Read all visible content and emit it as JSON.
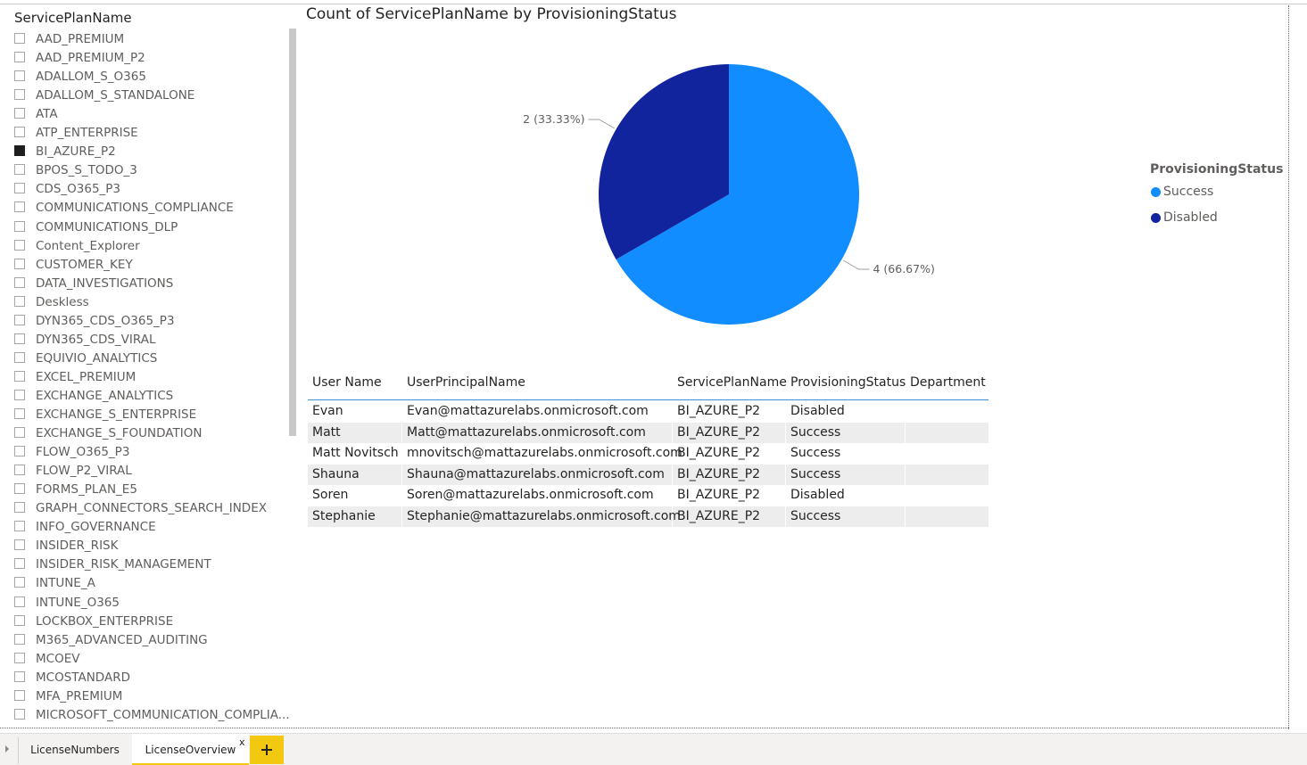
{
  "slicer": {
    "title": "ServicePlanName",
    "items": [
      {
        "label": "AAD_PREMIUM",
        "checked": false
      },
      {
        "label": "AAD_PREMIUM_P2",
        "checked": false
      },
      {
        "label": "ADALLOM_S_O365",
        "checked": false
      },
      {
        "label": "ADALLOM_S_STANDALONE",
        "checked": false
      },
      {
        "label": "ATA",
        "checked": false
      },
      {
        "label": "ATP_ENTERPRISE",
        "checked": false
      },
      {
        "label": "BI_AZURE_P2",
        "checked": true
      },
      {
        "label": "BPOS_S_TODO_3",
        "checked": false
      },
      {
        "label": "CDS_O365_P3",
        "checked": false
      },
      {
        "label": "COMMUNICATIONS_COMPLIANCE",
        "checked": false
      },
      {
        "label": "COMMUNICATIONS_DLP",
        "checked": false
      },
      {
        "label": "Content_Explorer",
        "checked": false
      },
      {
        "label": "CUSTOMER_KEY",
        "checked": false
      },
      {
        "label": "DATA_INVESTIGATIONS",
        "checked": false
      },
      {
        "label": "Deskless",
        "checked": false
      },
      {
        "label": "DYN365_CDS_O365_P3",
        "checked": false
      },
      {
        "label": "DYN365_CDS_VIRAL",
        "checked": false
      },
      {
        "label": "EQUIVIO_ANALYTICS",
        "checked": false
      },
      {
        "label": "EXCEL_PREMIUM",
        "checked": false
      },
      {
        "label": "EXCHANGE_ANALYTICS",
        "checked": false
      },
      {
        "label": "EXCHANGE_S_ENTERPRISE",
        "checked": false
      },
      {
        "label": "EXCHANGE_S_FOUNDATION",
        "checked": false
      },
      {
        "label": "FLOW_O365_P3",
        "checked": false
      },
      {
        "label": "FLOW_P2_VIRAL",
        "checked": false
      },
      {
        "label": "FORMS_PLAN_E5",
        "checked": false
      },
      {
        "label": "GRAPH_CONNECTORS_SEARCH_INDEX",
        "checked": false
      },
      {
        "label": "INFO_GOVERNANCE",
        "checked": false
      },
      {
        "label": "INSIDER_RISK",
        "checked": false
      },
      {
        "label": "INSIDER_RISK_MANAGEMENT",
        "checked": false
      },
      {
        "label": "INTUNE_A",
        "checked": false
      },
      {
        "label": "INTUNE_O365",
        "checked": false
      },
      {
        "label": "LOCKBOX_ENTERPRISE",
        "checked": false
      },
      {
        "label": "M365_ADVANCED_AUDITING",
        "checked": false
      },
      {
        "label": "MCOEV",
        "checked": false
      },
      {
        "label": "MCOSTANDARD",
        "checked": false
      },
      {
        "label": "MFA_PREMIUM",
        "checked": false
      },
      {
        "label": "MICROSOFT_COMMUNICATION_COMPLIA...",
        "checked": false
      }
    ]
  },
  "chart_data": {
    "type": "pie",
    "title": "Count of ServicePlanName by ProvisioningStatus",
    "legend_title": "ProvisioningStatus",
    "legend_position": "right",
    "categories": [
      "Success",
      "Disabled"
    ],
    "values": [
      4,
      2
    ],
    "colors": [
      "#118dff",
      "#12239e"
    ],
    "data_labels": [
      "4 (66.67%)",
      "2 (33.33%)"
    ]
  },
  "table": {
    "columns": [
      "User Name",
      "UserPrincipalName",
      "ServicePlanName",
      "ProvisioningStatus",
      "Department"
    ],
    "rows": [
      [
        "Evan",
        "Evan@mattazurelabs.onmicrosoft.com",
        "BI_AZURE_P2",
        "Disabled",
        ""
      ],
      [
        "Matt",
        "Matt@mattazurelabs.onmicrosoft.com",
        "BI_AZURE_P2",
        "Success",
        ""
      ],
      [
        "Matt Novitsch",
        "mnovitsch@mattazurelabs.onmicrosoft.com",
        "BI_AZURE_P2",
        "Success",
        ""
      ],
      [
        "Shauna",
        "Shauna@mattazurelabs.onmicrosoft.com",
        "BI_AZURE_P2",
        "Success",
        ""
      ],
      [
        "Soren",
        "Soren@mattazurelabs.onmicrosoft.com",
        "BI_AZURE_P2",
        "Disabled",
        ""
      ],
      [
        "Stephanie",
        "Stephanie@mattazurelabs.onmicrosoft.com",
        "BI_AZURE_P2",
        "Success",
        ""
      ]
    ]
  },
  "tabs": {
    "items": [
      {
        "label": "LicenseNumbers",
        "active": false
      },
      {
        "label": "LicenseOverview",
        "active": true
      }
    ],
    "close_label": "x",
    "add_icon": "plus-icon",
    "accent": "#f2c811"
  }
}
